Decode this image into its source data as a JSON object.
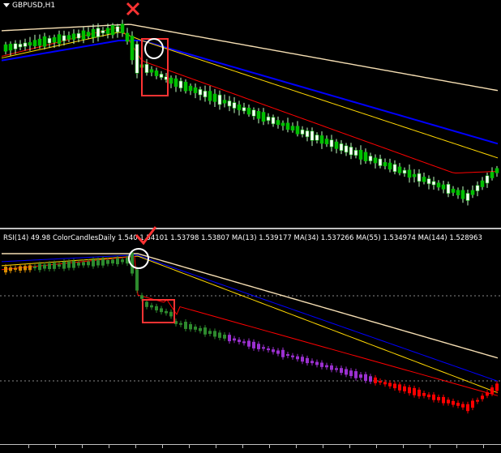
{
  "window": {
    "chart_title": "GBPUSD,H1",
    "subchart_label": "RSI(14) 49.98 ColorCandlesDaily 1.540 1.54101 1.53798 1.53807 MA(13) 1.539177 MA(34) 1.537266 MA(55) 1.534974 MA(144) 1.528963"
  },
  "colors": {
    "background": "#000000",
    "bull_top": "#ffffff",
    "bear_top": "#00c000",
    "ma13": "#ff0000",
    "ma34": "#ffd700",
    "ma55": "#0000ff",
    "ma144": "#f5deb3",
    "annotation": "#ff3333",
    "circle": "#ffffff",
    "bottom_green": "#2e8b2e",
    "bottom_purple": "#9b30d0",
    "bottom_red": "#ff0000",
    "bottom_orange": "#d98c00"
  },
  "icons": {
    "cross": "x-mark-icon",
    "check": "checkmark-icon",
    "circle": "highlight-circle-icon"
  }
}
